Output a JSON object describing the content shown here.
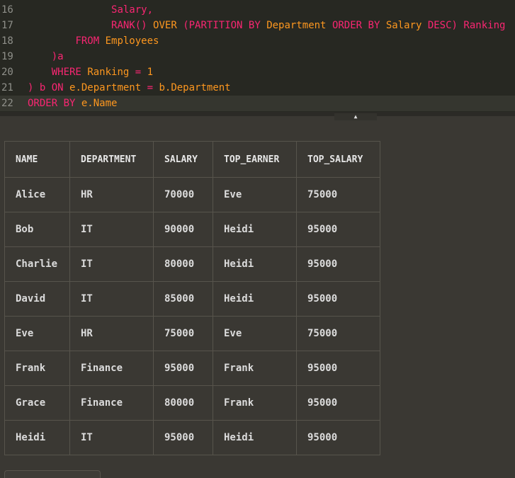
{
  "editor": {
    "lines": [
      {
        "num": "16",
        "tokens": [
          {
            "t": "              "
          },
          {
            "t": "Salary,",
            "c": "id"
          }
        ]
      },
      {
        "num": "17",
        "tokens": [
          {
            "t": "              "
          },
          {
            "t": "RANK()",
            "c": "kw"
          },
          {
            "t": " "
          },
          {
            "t": "OVER",
            "c": "fn"
          },
          {
            "t": " "
          },
          {
            "t": "(PARTITION BY",
            "c": "kw"
          },
          {
            "t": " "
          },
          {
            "t": "Department",
            "c": "fn"
          },
          {
            "t": " "
          },
          {
            "t": "ORDER BY",
            "c": "kw"
          },
          {
            "t": " "
          },
          {
            "t": "Salary",
            "c": "fn"
          },
          {
            "t": " "
          },
          {
            "t": "DESC)",
            "c": "kw"
          },
          {
            "t": " "
          },
          {
            "t": "Ranking",
            "c": "id"
          }
        ]
      },
      {
        "num": "18",
        "tokens": [
          {
            "t": "        "
          },
          {
            "t": "FROM",
            "c": "kw"
          },
          {
            "t": " "
          },
          {
            "t": "Employees",
            "c": "fn"
          }
        ]
      },
      {
        "num": "19",
        "tokens": [
          {
            "t": "    "
          },
          {
            "t": ")a",
            "c": "id"
          }
        ]
      },
      {
        "num": "20",
        "tokens": [
          {
            "t": "    "
          },
          {
            "t": "WHERE",
            "c": "kw"
          },
          {
            "t": " "
          },
          {
            "t": "Ranking",
            "c": "fn"
          },
          {
            "t": " = ",
            "c": "kw"
          },
          {
            "t": "1",
            "c": "fn"
          }
        ]
      },
      {
        "num": "21",
        "tokens": [
          {
            "t": ") b ",
            "c": "id"
          },
          {
            "t": "ON",
            "c": "kw"
          },
          {
            "t": " "
          },
          {
            "t": "e.Department",
            "c": "fn"
          },
          {
            "t": " = ",
            "c": "kw"
          },
          {
            "t": "b.Department",
            "c": "fn"
          }
        ]
      },
      {
        "num": "22",
        "active": true,
        "tokens": [
          {
            "t": "ORDER BY",
            "c": "kw"
          },
          {
            "t": " "
          },
          {
            "t": "e.Name",
            "c": "fn"
          }
        ]
      }
    ]
  },
  "splitter": {
    "handle_glyph": "▲"
  },
  "results": {
    "columns": [
      "NAME",
      "DEPARTMENT",
      "SALARY",
      "TOP_EARNER",
      "TOP_SALARY"
    ],
    "rows": [
      [
        "Alice",
        "HR",
        "70000",
        "Eve",
        "75000"
      ],
      [
        "Bob",
        "IT",
        "90000",
        "Heidi",
        "95000"
      ],
      [
        "Charlie",
        "IT",
        "80000",
        "Heidi",
        "95000"
      ],
      [
        "David",
        "IT",
        "85000",
        "Heidi",
        "95000"
      ],
      [
        "Eve",
        "HR",
        "75000",
        "Eve",
        "75000"
      ],
      [
        "Frank",
        "Finance",
        "95000",
        "Frank",
        "95000"
      ],
      [
        "Grace",
        "Finance",
        "80000",
        "Frank",
        "95000"
      ],
      [
        "Heidi",
        "IT",
        "95000",
        "Heidi",
        "95000"
      ]
    ]
  }
}
